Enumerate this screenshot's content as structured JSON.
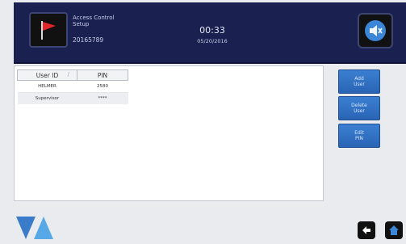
{
  "header": {
    "title_line1": "Access Control",
    "title_line2": "Setup",
    "serial": "20165789",
    "time": "00:33",
    "date": "05/20/2016",
    "flag_icon": "red-flag-icon",
    "audio_icon": "speaker-mute-icon"
  },
  "table": {
    "headers": [
      "User ID",
      "PIN"
    ],
    "rows": [
      {
        "user": "HELMER",
        "pin": "2580"
      },
      {
        "user": "Supervisor",
        "pin": "****"
      }
    ]
  },
  "buttons": {
    "add": "Add\nUser",
    "delete": "Delete\nUser",
    "edit": "Edit\nPIN"
  },
  "footer": {
    "logo_icon": "helmer-logo",
    "back_icon": "back-arrow-icon",
    "home_icon": "home-icon"
  },
  "colors": {
    "header_bg": "#1a2150",
    "button_blue": "#2a64b4",
    "flag_red": "#e1262c"
  }
}
